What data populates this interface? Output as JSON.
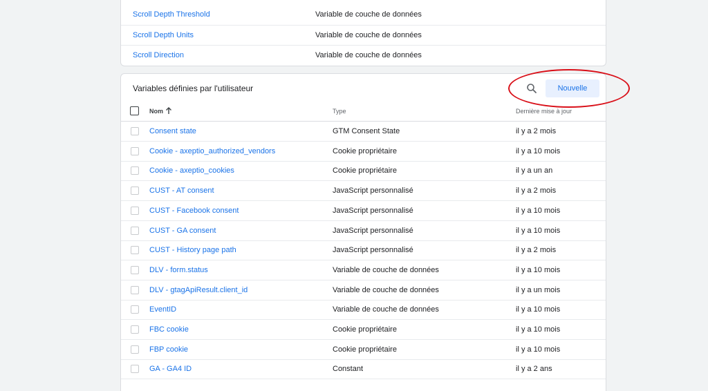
{
  "builtin_rows": [
    {
      "name": "Scroll Depth Threshold",
      "type": "Variable de couche de données"
    },
    {
      "name": "Scroll Depth Units",
      "type": "Variable de couche de données"
    },
    {
      "name": "Scroll Direction",
      "type": "Variable de couche de données"
    }
  ],
  "user_section": {
    "title": "Variables définies par l'utilisateur",
    "new_label": "Nouvelle",
    "search_icon": "search-icon",
    "highlight_color": "#d90f18",
    "columns": {
      "name": "Nom",
      "type": "Type",
      "date": "Dernière mise à jour"
    },
    "rows": [
      {
        "name": "Consent state",
        "type": "GTM Consent State",
        "date": "il y a 2 mois"
      },
      {
        "name": "Cookie - axeptio_authorized_vendors",
        "type": "Cookie propriétaire",
        "date": "il y a 10 mois"
      },
      {
        "name": "Cookie - axeptio_cookies",
        "type": "Cookie propriétaire",
        "date": "il y a un an"
      },
      {
        "name": "CUST - AT consent",
        "type": "JavaScript personnalisé",
        "date": "il y a 2 mois"
      },
      {
        "name": "CUST - Facebook consent",
        "type": "JavaScript personnalisé",
        "date": "il y a 10 mois"
      },
      {
        "name": "CUST - GA consent",
        "type": "JavaScript personnalisé",
        "date": "il y a 10 mois"
      },
      {
        "name": "CUST - History page path",
        "type": "JavaScript personnalisé",
        "date": "il y a 2 mois"
      },
      {
        "name": "DLV - form.status",
        "type": "Variable de couche de données",
        "date": "il y a 10 mois"
      },
      {
        "name": "DLV - gtagApiResult.client_id",
        "type": "Variable de couche de données",
        "date": "il y a un mois"
      },
      {
        "name": "EventID",
        "type": "Variable de couche de données",
        "date": "il y a 10 mois"
      },
      {
        "name": "FBC cookie",
        "type": "Cookie propriétaire",
        "date": "il y a 10 mois"
      },
      {
        "name": "FBP cookie",
        "type": "Cookie propriétaire",
        "date": "il y a 10 mois"
      },
      {
        "name": "GA - GA4 ID",
        "type": "Constant",
        "date": "il y a 2 ans"
      }
    ]
  },
  "colors": {
    "link": "#1a73e8",
    "button_bg": "#e8f0fe",
    "page_bg": "#f1f3f4"
  }
}
